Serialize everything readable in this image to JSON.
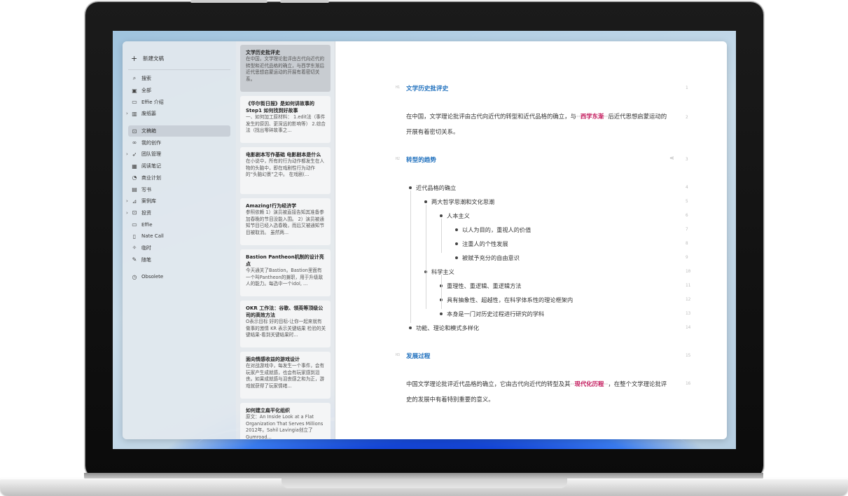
{
  "sidebar": {
    "new_doc": "新建文稿",
    "items": [
      {
        "label": "搜索",
        "icon": "search-icon"
      },
      {
        "label": "全部",
        "icon": "all-docs-icon"
      },
      {
        "label": "Effie 介绍",
        "icon": "doc-icon"
      },
      {
        "label": "废纸篓",
        "icon": "trash-icon",
        "expandable": true
      },
      {
        "label": "文稿箱",
        "icon": "inbox-icon",
        "active": true
      },
      {
        "label": "我的创作",
        "icon": "glasses-icon"
      },
      {
        "label": "团队管理",
        "icon": "rocket-icon",
        "expandable": true
      },
      {
        "label": "阅读笔记",
        "icon": "building-icon"
      },
      {
        "label": "商业计划",
        "icon": "compass-icon"
      },
      {
        "label": "写书",
        "icon": "book-icon"
      },
      {
        "label": "案例库",
        "icon": "chart-icon",
        "expandable": true
      },
      {
        "label": "投资",
        "icon": "inbox-icon",
        "expandable": true
      },
      {
        "label": "Effie",
        "icon": "folder-icon"
      },
      {
        "label": "Nate Call",
        "icon": "mic-icon"
      },
      {
        "label": "临时",
        "icon": "pin-icon"
      },
      {
        "label": "随笔",
        "icon": "pen-icon"
      },
      {
        "label": "Obsolete",
        "icon": "clock-icon"
      }
    ]
  },
  "doclist": [
    {
      "title": "文学历史批评史",
      "body": "在中国，文学理论批评由古代向近代的转型和近代品格的确立，与西学东渐后近代思想启蒙运动的开展有着密切关系。"
    },
    {
      "title": "《华尔街日报》是如何讲故事的 Step1 如何找到好故事",
      "body": "一、如何加工原材料： 1.edit法（事件发生的原因、更深远的影响等） 2.综合法（找出零碎故事之..."
    },
    {
      "title": "电影剧本写作基础 电影剧本是什么",
      "body": "在小说中，所有的行为动作都发生在人物的头脑中，即在戏剧性行为动作的“头脑幻景”之中。 在戏剧(..."
    },
    {
      "title": "Amazing!行为经济学",
      "body": "参照依赖 1）演员被直接告知其准备参加春晚的节目没能入围。 2）演员被通知节目已经入选春晚，而后又被通知节目被取消。 虽然两..."
    },
    {
      "title": "Bastion Pantheon机制的设计亮点",
      "body": "今天通关了Bastion。Bastion里面有一个叫Pantheon的兼职，用于升级敌人的能力。每选中一个idol, ..."
    },
    {
      "title": "OKR 工作法：谷歌、领英等顶级公司的高效方法",
      "body": "O表示目标 好的目标-让你一起来就有做事的激情 KR 表示关键结果 检验的关键结果-看到关键结果时..."
    },
    {
      "title": "面向情感收益的游戏设计",
      "body": "在对战游戏中，每发生一个事件，会有玩家产生成就感，也会有玩家感到沮丧。如果成就感与沮丧感之和为正，游戏就获得了玩家情绪..."
    },
    {
      "title": "如何建立扁平化组织",
      "body": "原文：An Inside Look at a Flat Organization That Serves Millions 2012年。Sahil Lavingia创立了Gumroad..."
    }
  ],
  "editor": {
    "h1": {
      "mark": "H1",
      "text": "文学历史批评史",
      "num": "1"
    },
    "p1": {
      "before": "在中国，文学理论批评由古代向近代的转型和近代品格的确立，与",
      "mk_open": "**",
      "highlight": "西学东渐",
      "mk_close": "**",
      "after": "后近代思想启蒙运动的开展有着密切关系。",
      "num": "2"
    },
    "h2": {
      "mark": "H2",
      "text": "转型的趋势",
      "num": "3"
    },
    "bullets": [
      {
        "text": "近代品格的确立",
        "num": "4"
      },
      {
        "text": "两大哲学思潮和文化思潮",
        "num": "5"
      },
      {
        "text": "人本主义",
        "num": "6"
      },
      {
        "text": "以人为目的，重视人的价值",
        "num": "7"
      },
      {
        "text": "注重人的个性发展",
        "num": "8"
      },
      {
        "text": "被赋予充分的自由意识",
        "num": "9"
      },
      {
        "text": "科学主义",
        "num": "10"
      },
      {
        "text": "重理性、重逻辑、重逻辑方法",
        "num": "11"
      },
      {
        "text": "具有抽象性、超越性，在科学体系性的理论框架内",
        "num": "12"
      },
      {
        "text": "本身是一门对历史过程进行研究的学科",
        "num": "13"
      },
      {
        "text": "功能、理论和模式多样化",
        "num": "14"
      }
    ],
    "h3": {
      "mark": "H3",
      "text": "发展过程",
      "num": "15"
    },
    "p2": {
      "before": "中国文学理论批评近代品格的确立，它由古代向近代的转型及其",
      "mk_open": "**",
      "highlight": "现代化历程",
      "mk_close": "**",
      "after": "，在整个文学理论批评史的发展中有着特别重要的意义。",
      "num": "16"
    }
  }
}
